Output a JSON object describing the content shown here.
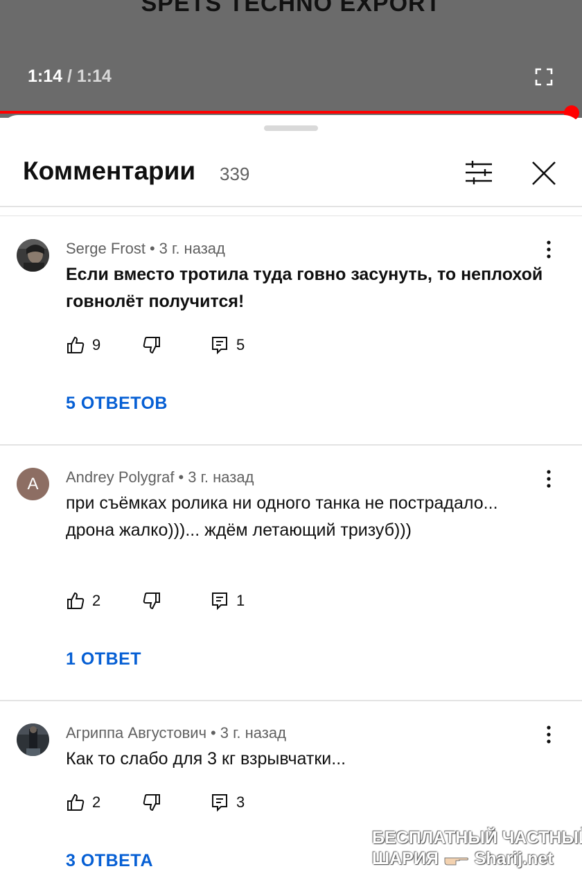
{
  "video": {
    "title": "SPETS TECHNO EXPORT",
    "current_time": "1:14",
    "separator": " / ",
    "duration": "1:14",
    "progress": 1.0
  },
  "panel": {
    "title": "Комментарии",
    "count": "339"
  },
  "comments": [
    {
      "author": "Serge Frost",
      "time": "3 г. назад",
      "text": "Если вместо тротила туда говно засунуть, то неплохой говнолёт получится!",
      "likes": "9",
      "reply_count": "5",
      "replies_label": "5 ОТВЕТОВ"
    },
    {
      "author": "Andrey Polygraf",
      "avatar_letter": "A",
      "time": "3 г. назад",
      "text": "при съёмках ролика ни одного танка не пострадало... дрона жалко)))... ждём летающий тризуб)))",
      "likes": "2",
      "reply_count": "1",
      "replies_label": "1 ОТВЕТ"
    },
    {
      "author": "Агриппа Августович",
      "time": "3 г. назад",
      "text": "Как то слабо для 3 кг взрывчатки...",
      "likes": "2",
      "reply_count": "3",
      "replies_label": "3 ОТВЕТА"
    }
  ],
  "watermark": {
    "line1": "БЕСПЛАТНЫЙ ЧАСТНЫЙ",
    "line2_left": "ШАРИЯ",
    "line2_right": "Sharij.net"
  },
  "colors": {
    "progress": "#ff0000",
    "link": "#065fd4",
    "video_bg": "#6b6b6b"
  }
}
